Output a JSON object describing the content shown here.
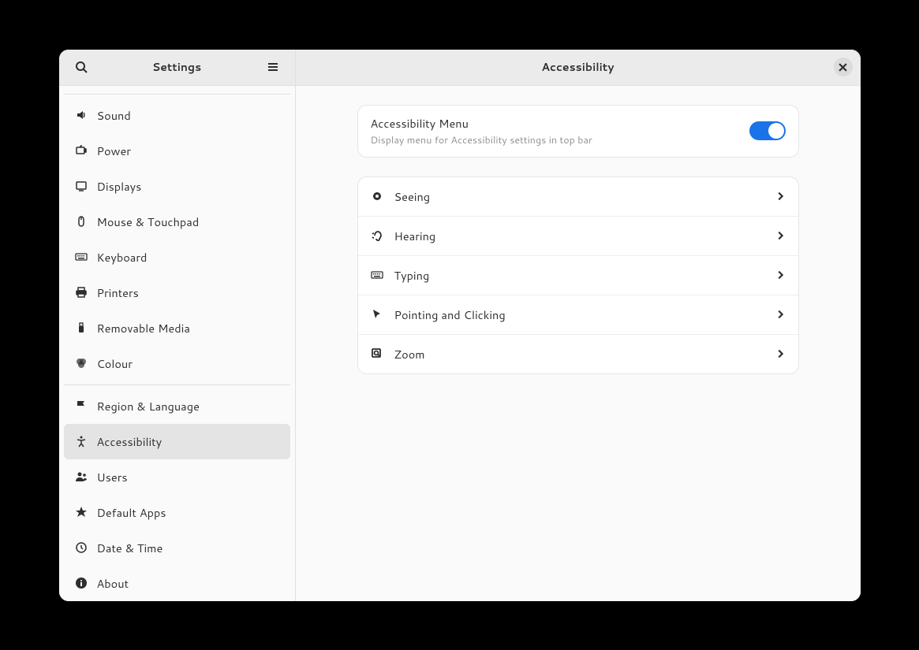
{
  "sidebar": {
    "title": "Settings",
    "groups": [
      {
        "items": [
          {
            "id": "sound",
            "label": "Sound",
            "icon": "sound"
          },
          {
            "id": "power",
            "label": "Power",
            "icon": "power"
          },
          {
            "id": "displays",
            "label": "Displays",
            "icon": "displays"
          },
          {
            "id": "mouse",
            "label": "Mouse & Touchpad",
            "icon": "mouse"
          },
          {
            "id": "keyboard",
            "label": "Keyboard",
            "icon": "keyboard"
          },
          {
            "id": "printers",
            "label": "Printers",
            "icon": "printers"
          },
          {
            "id": "removable",
            "label": "Removable Media",
            "icon": "usb"
          },
          {
            "id": "colour",
            "label": "Colour",
            "icon": "colour"
          }
        ]
      },
      {
        "items": [
          {
            "id": "region",
            "label": "Region & Language",
            "icon": "flag"
          },
          {
            "id": "accessibility",
            "label": "Accessibility",
            "icon": "accessibility",
            "selected": true
          },
          {
            "id": "users",
            "label": "Users",
            "icon": "users"
          },
          {
            "id": "defaultapps",
            "label": "Default Apps",
            "icon": "star"
          },
          {
            "id": "datetime",
            "label": "Date & Time",
            "icon": "clock"
          },
          {
            "id": "about",
            "label": "About",
            "icon": "info"
          }
        ]
      }
    ]
  },
  "content": {
    "title": "Accessibility",
    "toggle": {
      "title": "Accessibility Menu",
      "subtitle": "Display menu for Accessibility settings in top bar",
      "enabled": true
    },
    "rows": [
      {
        "id": "seeing",
        "label": "Seeing",
        "icon": "eye"
      },
      {
        "id": "hearing",
        "label": "Hearing",
        "icon": "ear"
      },
      {
        "id": "typing",
        "label": "Typing",
        "icon": "keyboard"
      },
      {
        "id": "pointing",
        "label": "Pointing and Clicking",
        "icon": "cursor"
      },
      {
        "id": "zoom",
        "label": "Zoom",
        "icon": "zoom"
      }
    ]
  },
  "colors": {
    "accent": "#1a73e8"
  }
}
